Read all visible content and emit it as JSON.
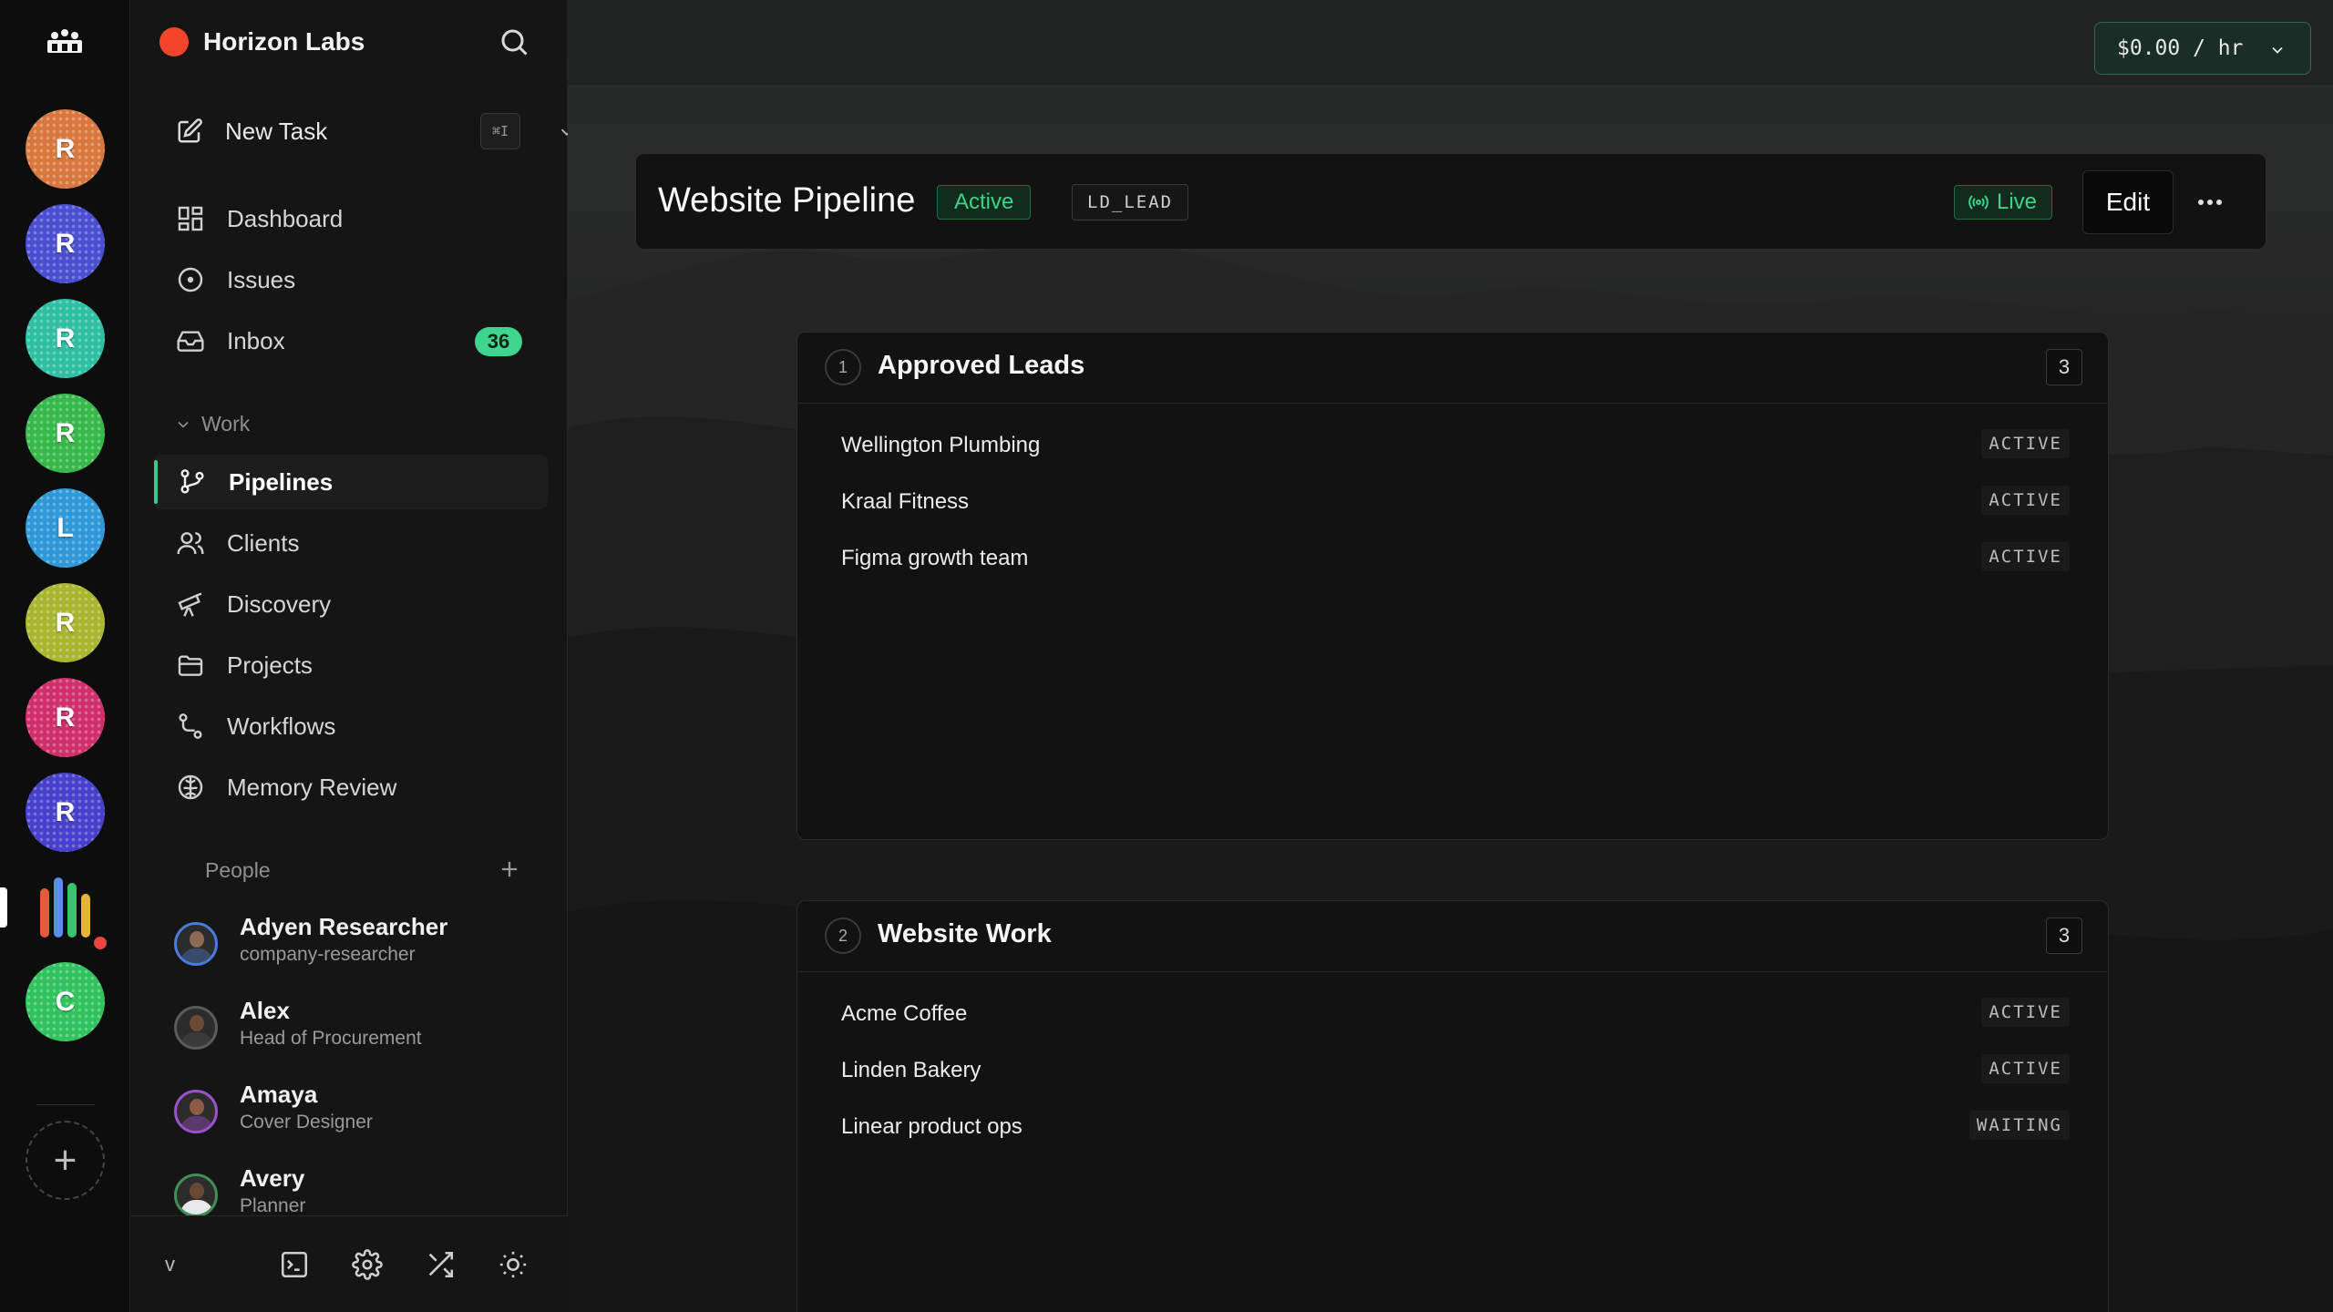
{
  "rail": {
    "workspaces": [
      {
        "letter": "R",
        "color": "#d9783e"
      },
      {
        "letter": "R",
        "color": "#4a4ed0"
      },
      {
        "letter": "R",
        "color": "#2fbfa3"
      },
      {
        "letter": "R",
        "color": "#36b84a"
      },
      {
        "letter": "L",
        "color": "#2f98d8"
      },
      {
        "letter": "R",
        "color": "#a9b62e"
      },
      {
        "letter": "R",
        "color": "#cf2f6a"
      },
      {
        "letter": "R",
        "color": "#4740cc"
      },
      {
        "letter": "C",
        "color": "#31c25e"
      }
    ],
    "add_label": "+"
  },
  "sidebar": {
    "org_name": "Horizon Labs",
    "new_task": {
      "label": "New Task",
      "shortcut": "⌘I"
    },
    "nav": [
      {
        "label": "Dashboard",
        "icon": "dashboard-icon"
      },
      {
        "label": "Issues",
        "icon": "issues-icon"
      },
      {
        "label": "Inbox",
        "icon": "inbox-icon",
        "badge": "36"
      }
    ],
    "work_section": {
      "label": "Work",
      "items": [
        {
          "label": "Pipelines",
          "icon": "pipelines-icon",
          "active": true
        },
        {
          "label": "Clients",
          "icon": "clients-icon"
        },
        {
          "label": "Discovery",
          "icon": "telescope-icon"
        },
        {
          "label": "Projects",
          "icon": "folder-icon"
        },
        {
          "label": "Workflows",
          "icon": "workflow-icon"
        },
        {
          "label": "Memory Review",
          "icon": "brain-icon"
        }
      ]
    },
    "people_section": {
      "label": "People",
      "people": [
        {
          "name": "Adyen Researcher",
          "role": "company-researcher"
        },
        {
          "name": "Alex",
          "role": "Head of Procurement"
        },
        {
          "name": "Amaya",
          "role": "Cover Designer"
        },
        {
          "name": "Avery",
          "role": "Planner"
        }
      ]
    },
    "version": "v"
  },
  "topbar": {
    "rate": "$0.00 / hr"
  },
  "pipeline": {
    "title": "Website Pipeline",
    "status": "Active",
    "code": "LD_LEAD",
    "live_label": "Live",
    "edit_label": "Edit",
    "stages": [
      {
        "number": "1",
        "name": "Approved Leads",
        "count": "3",
        "items": [
          {
            "client": "Wellington Plumbing",
            "status": "ACTIVE"
          },
          {
            "client": "Kraal Fitness",
            "status": "ACTIVE"
          },
          {
            "client": "Figma growth team",
            "status": "ACTIVE"
          }
        ]
      },
      {
        "number": "2",
        "name": "Website Work",
        "count": "3",
        "items": [
          {
            "client": "Acme Coffee",
            "status": "ACTIVE"
          },
          {
            "client": "Linden Bakery",
            "status": "ACTIVE"
          },
          {
            "client": "Linear product ops",
            "status": "WAITING"
          }
        ]
      }
    ]
  },
  "colors": {
    "accent_green": "#3dd68c",
    "org_dot": "#f4452b",
    "notification_dot": "#e8463f"
  }
}
